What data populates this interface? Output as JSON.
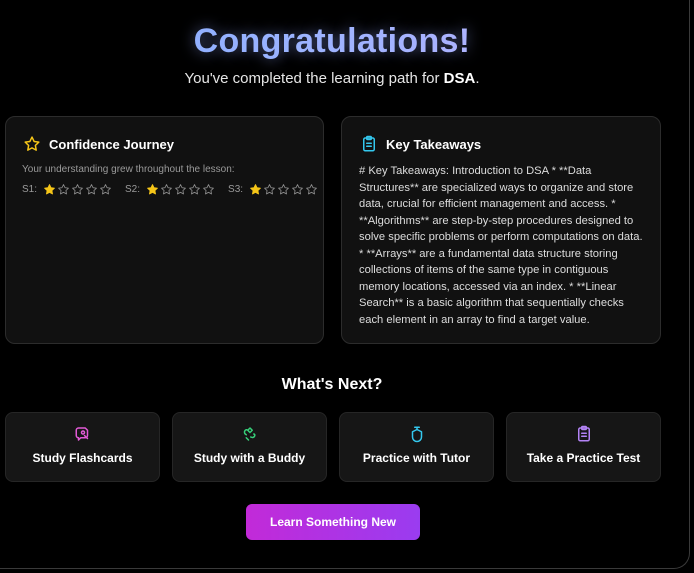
{
  "header": {
    "title": "Congratulations!",
    "subtitle_prefix": "You've completed the learning path for ",
    "subject": "DSA",
    "subtitle_suffix": "."
  },
  "confidence": {
    "title": "Confidence Journey",
    "description": "Your understanding grew throughout the lesson:",
    "ratings": [
      {
        "label": "S1:",
        "stars": 1,
        "max": 5
      },
      {
        "label": "S2:",
        "stars": 1,
        "max": 5
      },
      {
        "label": "S3:",
        "stars": 1,
        "max": 5
      }
    ]
  },
  "takeaways": {
    "title": "Key Takeaways",
    "body": "# Key Takeaways: Introduction to DSA * **Data Structures** are specialized ways to organize and store data, crucial for efficient management and access. * **Algorithms** are step-by-step procedures designed to solve specific problems or perform computations on data. * **Arrays** are a fundamental data structure storing collections of items of the same type in contiguous memory locations, accessed via an index. * **Linear Search** is a basic algorithm that sequentially checks each element in an array to find a target value."
  },
  "next": {
    "title": "What's Next?",
    "actions": [
      {
        "label": "Study Flashcards",
        "icon": "flashcards-icon",
        "color": "#e25ad6"
      },
      {
        "label": "Study with a Buddy",
        "icon": "buddy-icon",
        "color": "#37d07a"
      },
      {
        "label": "Practice with Tutor",
        "icon": "tutor-icon",
        "color": "#34c8ee"
      },
      {
        "label": "Take a Practice Test",
        "icon": "clipboard-icon",
        "color": "#b383f5"
      }
    ],
    "learn_button": "Learn Something New"
  },
  "colors": {
    "star_filled": "#f5c518",
    "star_empty": "#8a8a8a",
    "confidence_icon": "#f5c518",
    "takeaways_icon": "#34c8ee",
    "button_gradient_start": "#c22ad8",
    "button_gradient_end": "#9a3cf0"
  }
}
